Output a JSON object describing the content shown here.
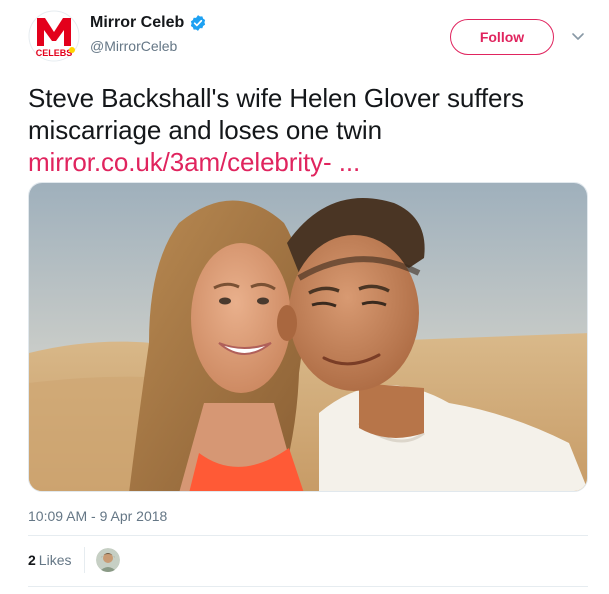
{
  "account": {
    "display_name": "Mirror Celeb",
    "handle": "@MirrorCeleb",
    "logo_letter": "M",
    "logo_text": "CELEBS",
    "brand_color": "#e0245e"
  },
  "header": {
    "follow_label": "Follow",
    "verified_icon": "verified-badge-icon",
    "caret_icon": "chevron-down-icon"
  },
  "tweet": {
    "text": "Steve Backshall's wife Helen Glover suffers miscarriage and loses one twin",
    "link": "mirror.co.uk/3am/celebrity-  ...",
    "link_color": "#e0245e"
  },
  "media": {
    "type": "photo",
    "image_icon": "couple-photo"
  },
  "footer": {
    "timestamp": "10:09 AM - 9 Apr 2018",
    "likes_count": "2",
    "likes_label": "Likes",
    "liker_avatar": "user-avatar"
  }
}
